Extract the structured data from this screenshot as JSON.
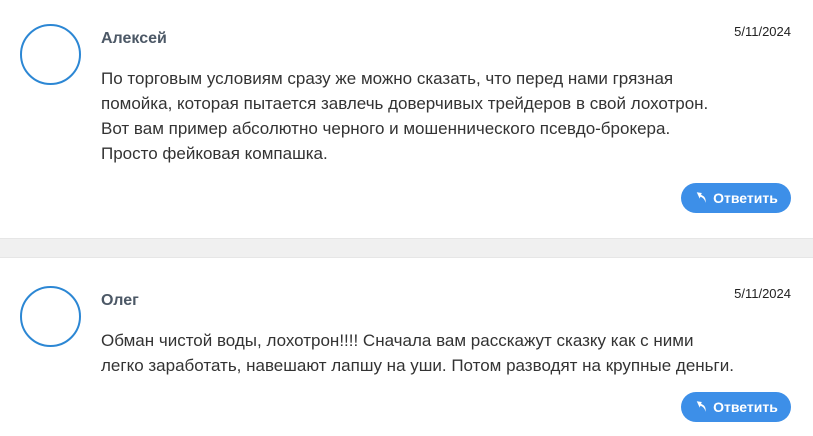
{
  "comments": [
    {
      "author": "Алексей",
      "date": "5/11/2024",
      "text_lines": [
        "По торговым условиям сразу же можно сказать, что перед нами грязная",
        "помойка, которая пытается завлечь доверчивых трейдеров в свой лохотрон.",
        "Вот вам пример абсолютно черного и мошеннического псевдо-брокера.",
        "Просто фейковая компашка."
      ],
      "reply_label": "Ответить",
      "reply_icon": "reply-arrow-icon"
    },
    {
      "author": "Олег",
      "date": "5/11/2024",
      "text_lines": [
        "Обман чистой воды, лохотрон!!!! Сначала вам расскажут сказку как с ними",
        "легко заработать, навешают лапшу на уши. Потом разводят на крупные деньги."
      ],
      "reply_label": "Ответить",
      "reply_icon": "reply-arrow-icon"
    }
  ],
  "colors": {
    "accent": "#3d8fe8",
    "avatar_border": "#2c87d4",
    "author": "#4c5866",
    "text": "#333333",
    "divider": "#f0f0f0"
  }
}
